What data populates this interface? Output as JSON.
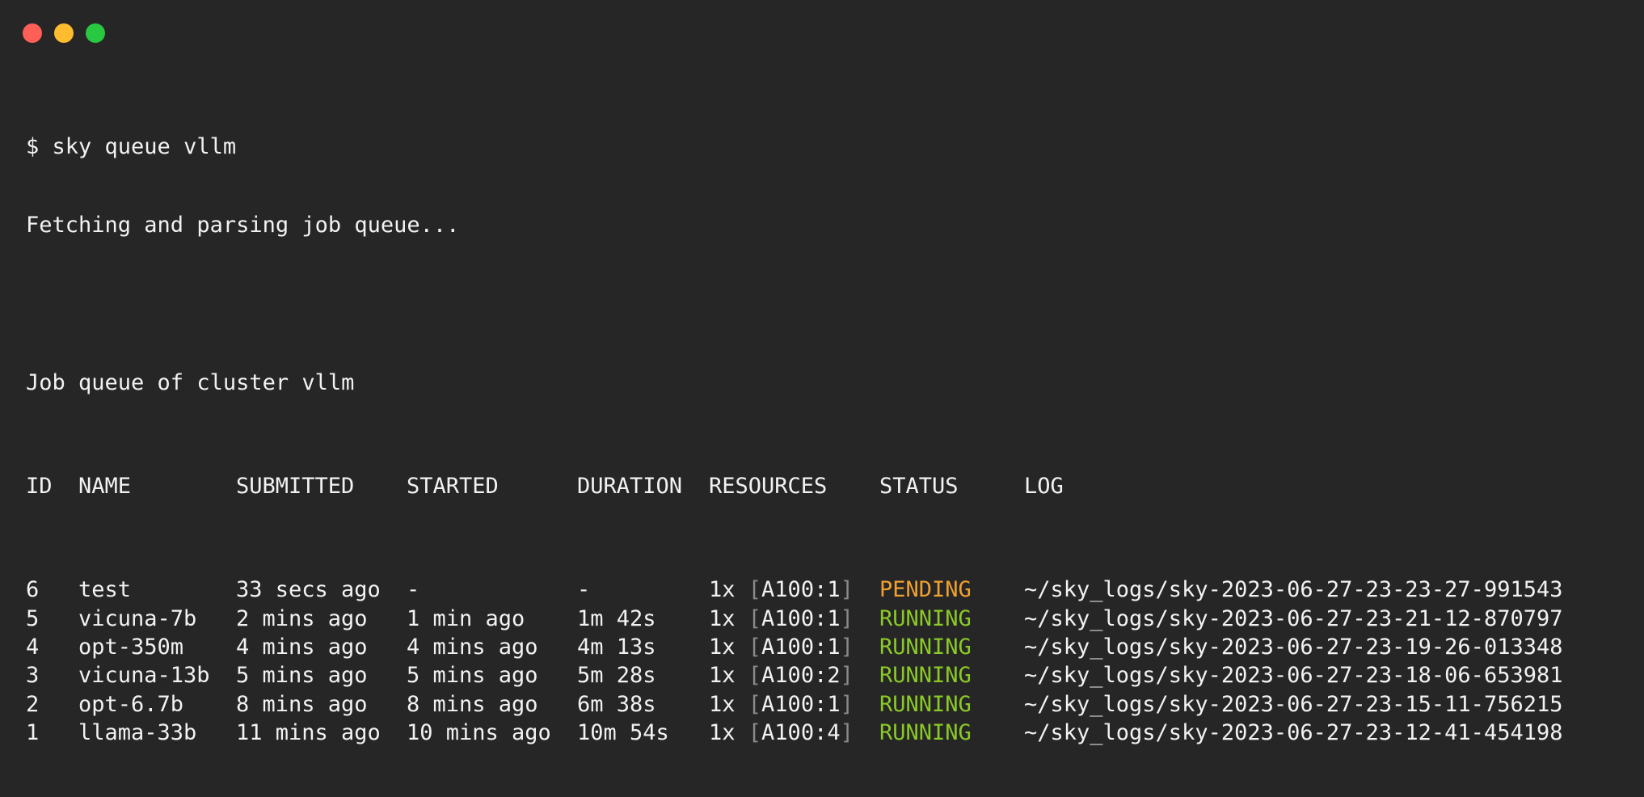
{
  "window": {
    "title_dots": [
      "close",
      "minimize",
      "maximize"
    ]
  },
  "terminal": {
    "command": "$ sky queue vllm",
    "status_line": "Fetching and parsing job queue...",
    "queue_title": "Job queue of cluster vllm",
    "headers": {
      "id": "ID",
      "name": "NAME",
      "submitted": "SUBMITTED",
      "started": "STARTED",
      "duration": "DURATION",
      "resources": "RESOURCES",
      "status": "STATUS",
      "log": "LOG"
    },
    "colors": {
      "pending": "#f0a030",
      "running": "#8ac926"
    },
    "jobs": [
      {
        "id": "6",
        "name": "test",
        "submitted": "33 secs ago",
        "started": "-",
        "duration": "-",
        "res_count": "1x",
        "res_lb": "[",
        "res_spec": "A100:1",
        "res_rb": "]",
        "status": "PENDING",
        "log": "~/sky_logs/sky-2023-06-27-23-23-27-991543"
      },
      {
        "id": "5",
        "name": "vicuna-7b",
        "submitted": "2 mins ago",
        "started": "1 min ago",
        "duration": "1m 42s",
        "res_count": "1x",
        "res_lb": "[",
        "res_spec": "A100:1",
        "res_rb": "]",
        "status": "RUNNING",
        "log": "~/sky_logs/sky-2023-06-27-23-21-12-870797"
      },
      {
        "id": "4",
        "name": "opt-350m",
        "submitted": "4 mins ago",
        "started": "4 mins ago",
        "duration": "4m 13s",
        "res_count": "1x",
        "res_lb": "[",
        "res_spec": "A100:1",
        "res_rb": "]",
        "status": "RUNNING",
        "log": "~/sky_logs/sky-2023-06-27-23-19-26-013348"
      },
      {
        "id": "3",
        "name": "vicuna-13b",
        "submitted": "5 mins ago",
        "started": "5 mins ago",
        "duration": "5m 28s",
        "res_count": "1x",
        "res_lb": "[",
        "res_spec": "A100:2",
        "res_rb": "]",
        "status": "RUNNING",
        "log": "~/sky_logs/sky-2023-06-27-23-18-06-653981"
      },
      {
        "id": "2",
        "name": "opt-6.7b",
        "submitted": "8 mins ago",
        "started": "8 mins ago",
        "duration": "6m 38s",
        "res_count": "1x",
        "res_lb": "[",
        "res_spec": "A100:1",
        "res_rb": "]",
        "status": "RUNNING",
        "log": "~/sky_logs/sky-2023-06-27-23-15-11-756215"
      },
      {
        "id": "1",
        "name": "llama-33b",
        "submitted": "11 mins ago",
        "started": "10 mins ago",
        "duration": "10m 54s",
        "res_count": "1x",
        "res_lb": "[",
        "res_spec": "A100:4",
        "res_rb": "]",
        "status": "RUNNING",
        "log": "~/sky_logs/sky-2023-06-27-23-12-41-454198"
      }
    ]
  }
}
